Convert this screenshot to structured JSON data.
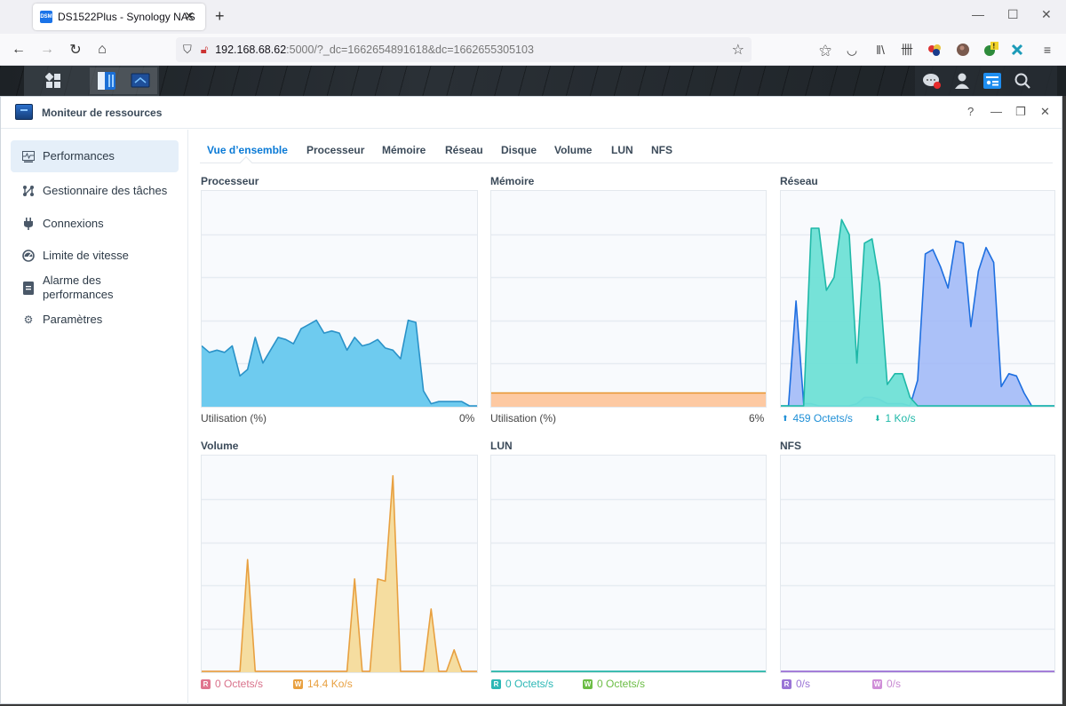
{
  "browser": {
    "tab_title": "DS1522Plus - Synology NAS",
    "favicon_label": "DSM",
    "url_host": "192.168.68.62",
    "url_rest": ":5000/?_dc=1662654891618&dc=1662655305103"
  },
  "window": {
    "title": "Moniteur de ressources",
    "help": "?",
    "minimize": "—",
    "restore": "❐",
    "close": "✕"
  },
  "sidebar": {
    "items": [
      {
        "label": "Performances",
        "icon": "performance-icon",
        "active": true
      },
      {
        "label": "Gestionnaire des tâches",
        "icon": "task-manager-icon"
      },
      {
        "label": "Connexions",
        "icon": "plug-icon"
      },
      {
        "label": "Limite de vitesse",
        "icon": "speedometer-icon"
      },
      {
        "label": "Alarme des performances",
        "icon": "alarm-clipboard-icon"
      },
      {
        "label": "Paramètres",
        "icon": "gear-icon"
      }
    ]
  },
  "tabs": [
    {
      "label": "Vue d’ensemble",
      "active": true
    },
    {
      "label": "Processeur"
    },
    {
      "label": "Mémoire"
    },
    {
      "label": "Réseau"
    },
    {
      "label": "Disque"
    },
    {
      "label": "Volume"
    },
    {
      "label": "LUN"
    },
    {
      "label": "NFS"
    }
  ],
  "panels": {
    "cpu": {
      "title": "Processeur",
      "caption": "Utilisation (%)",
      "value": "0%"
    },
    "memory": {
      "title": "Mémoire",
      "caption": "Utilisation (%)",
      "value": "6%"
    },
    "network": {
      "title": "Réseau",
      "upload": "459 Octets/s",
      "download": "1 Ko/s"
    },
    "volume": {
      "title": "Volume",
      "read_badge": "R",
      "read": "0 Octets/s",
      "write_badge": "W",
      "write": "14.4 Ko/s"
    },
    "lun": {
      "title": "LUN",
      "read_badge": "R",
      "read": "0 Octets/s",
      "write_badge": "W",
      "write": "0 Octets/s"
    },
    "nfs": {
      "title": "NFS",
      "read_badge": "R",
      "read": "0/s",
      "write_badge": "W",
      "write": "0/s"
    }
  },
  "colors": {
    "accent": "#0a7ad6",
    "cpu_fill": "#6ecbef",
    "cpu_line": "#2a92c8",
    "memory_fill": "#fdc9a2",
    "memory_line": "#e7952f",
    "net_up_fill": "#9db6f7",
    "net_up_line": "#1e6fe0",
    "net_down_fill": "#6fe0d6",
    "net_down_line": "#1fb8a8",
    "vol_read": "#e0758f",
    "vol_write_fill": "#f5dda0",
    "vol_write_line": "#e8a040",
    "lun_read": "#2bb7b5",
    "lun_write": "#6cbd45",
    "nfs_read": "#9a74d6",
    "nfs_write": "#d08ed8"
  },
  "chart_data": [
    {
      "name": "cpu",
      "type": "area",
      "title": "Processeur",
      "ylabel": "Utilisation (%)",
      "ylim": [
        0,
        100
      ],
      "grid": true,
      "series": [
        {
          "name": "Utilisation",
          "values": [
            28,
            25,
            26,
            25,
            28,
            14,
            17,
            32,
            20,
            26,
            32,
            31,
            29,
            36,
            38,
            40,
            34,
            35,
            34,
            26,
            32,
            28,
            29,
            31,
            27,
            26,
            22,
            40,
            39,
            7,
            1,
            2,
            2,
            2,
            2,
            0,
            0
          ]
        }
      ]
    },
    {
      "name": "memory",
      "type": "area",
      "title": "Mémoire",
      "ylabel": "Utilisation (%)",
      "ylim": [
        0,
        100
      ],
      "grid": true,
      "series": [
        {
          "name": "Utilisation",
          "values": [
            6,
            6,
            6,
            6,
            6,
            6,
            6,
            6,
            6,
            6,
            6,
            6,
            6,
            6,
            6,
            6,
            6,
            6,
            6,
            6,
            6,
            6,
            6,
            6,
            6,
            6,
            6,
            6,
            6,
            6,
            6,
            6,
            6,
            6,
            6,
            6,
            6
          ]
        }
      ]
    },
    {
      "name": "network",
      "type": "area",
      "title": "Réseau",
      "ylim": [
        0,
        100
      ],
      "grid": true,
      "series": [
        {
          "name": "Upload",
          "values": [
            0,
            0,
            0,
            0,
            83,
            83,
            54,
            60,
            87,
            80,
            20,
            76,
            78,
            57,
            10,
            15,
            15,
            4,
            0,
            0,
            0,
            0,
            0,
            0,
            0,
            0,
            0,
            0,
            0,
            0,
            0,
            0,
            0,
            0,
            0,
            0,
            0
          ]
        },
        {
          "name": "Download",
          "values": [
            0,
            0,
            49,
            1,
            1,
            0,
            0,
            0,
            0,
            0,
            1,
            4,
            4,
            3,
            1,
            1,
            1,
            0,
            12,
            71,
            73,
            65,
            55,
            77,
            76,
            37,
            63,
            74,
            67,
            9,
            15,
            14,
            6,
            0,
            0,
            0,
            0
          ]
        }
      ]
    },
    {
      "name": "volume",
      "type": "area",
      "title": "Volume",
      "ylim": [
        0,
        100
      ],
      "grid": true,
      "series": [
        {
          "name": "R",
          "values": [
            0,
            0,
            0,
            0,
            0,
            0,
            0,
            0,
            0,
            0,
            0,
            0,
            0,
            0,
            0,
            0,
            0,
            0,
            0,
            0,
            0,
            0,
            0,
            0,
            0,
            0,
            0,
            0,
            0,
            0,
            0,
            0,
            0,
            0,
            0,
            0,
            0
          ]
        },
        {
          "name": "W",
          "values": [
            0,
            0,
            0,
            0,
            0,
            0,
            52,
            0,
            0,
            0,
            0,
            0,
            0,
            0,
            0,
            0,
            0,
            0,
            0,
            0,
            43,
            0,
            0,
            43,
            42,
            91,
            0,
            0,
            0,
            0,
            29,
            0,
            0,
            10,
            0,
            0,
            0
          ]
        }
      ]
    },
    {
      "name": "lun",
      "type": "area",
      "title": "LUN",
      "ylim": [
        0,
        100
      ],
      "grid": true,
      "series": [
        {
          "name": "R",
          "values": [
            0,
            0,
            0,
            0,
            0,
            0,
            0,
            0,
            0,
            0,
            0,
            0,
            0,
            0,
            0,
            0,
            0,
            0,
            0,
            0,
            0,
            0,
            0,
            0,
            0,
            0,
            0,
            0,
            0,
            0,
            0,
            0,
            0,
            0,
            0,
            0,
            0
          ]
        },
        {
          "name": "W",
          "values": [
            0,
            0,
            0,
            0,
            0,
            0,
            0,
            0,
            0,
            0,
            0,
            0,
            0,
            0,
            0,
            0,
            0,
            0,
            0,
            0,
            0,
            0,
            0,
            0,
            0,
            0,
            0,
            0,
            0,
            0,
            0,
            0,
            0,
            0,
            0,
            0,
            0
          ]
        }
      ]
    },
    {
      "name": "nfs",
      "type": "area",
      "title": "NFS",
      "ylim": [
        0,
        100
      ],
      "grid": true,
      "series": [
        {
          "name": "R",
          "values": [
            0,
            0,
            0,
            0,
            0,
            0,
            0,
            0,
            0,
            0,
            0,
            0,
            0,
            0,
            0,
            0,
            0,
            0,
            0,
            0,
            0,
            0,
            0,
            0,
            0,
            0,
            0,
            0,
            0,
            0,
            0,
            0,
            0,
            0,
            0,
            0,
            0
          ]
        },
        {
          "name": "W",
          "values": [
            0,
            0,
            0,
            0,
            0,
            0,
            0,
            0,
            0,
            0,
            0,
            0,
            0,
            0,
            0,
            0,
            0,
            0,
            0,
            0,
            0,
            0,
            0,
            0,
            0,
            0,
            0,
            0,
            0,
            0,
            0,
            0,
            0,
            0,
            0,
            0,
            0
          ]
        }
      ]
    }
  ]
}
